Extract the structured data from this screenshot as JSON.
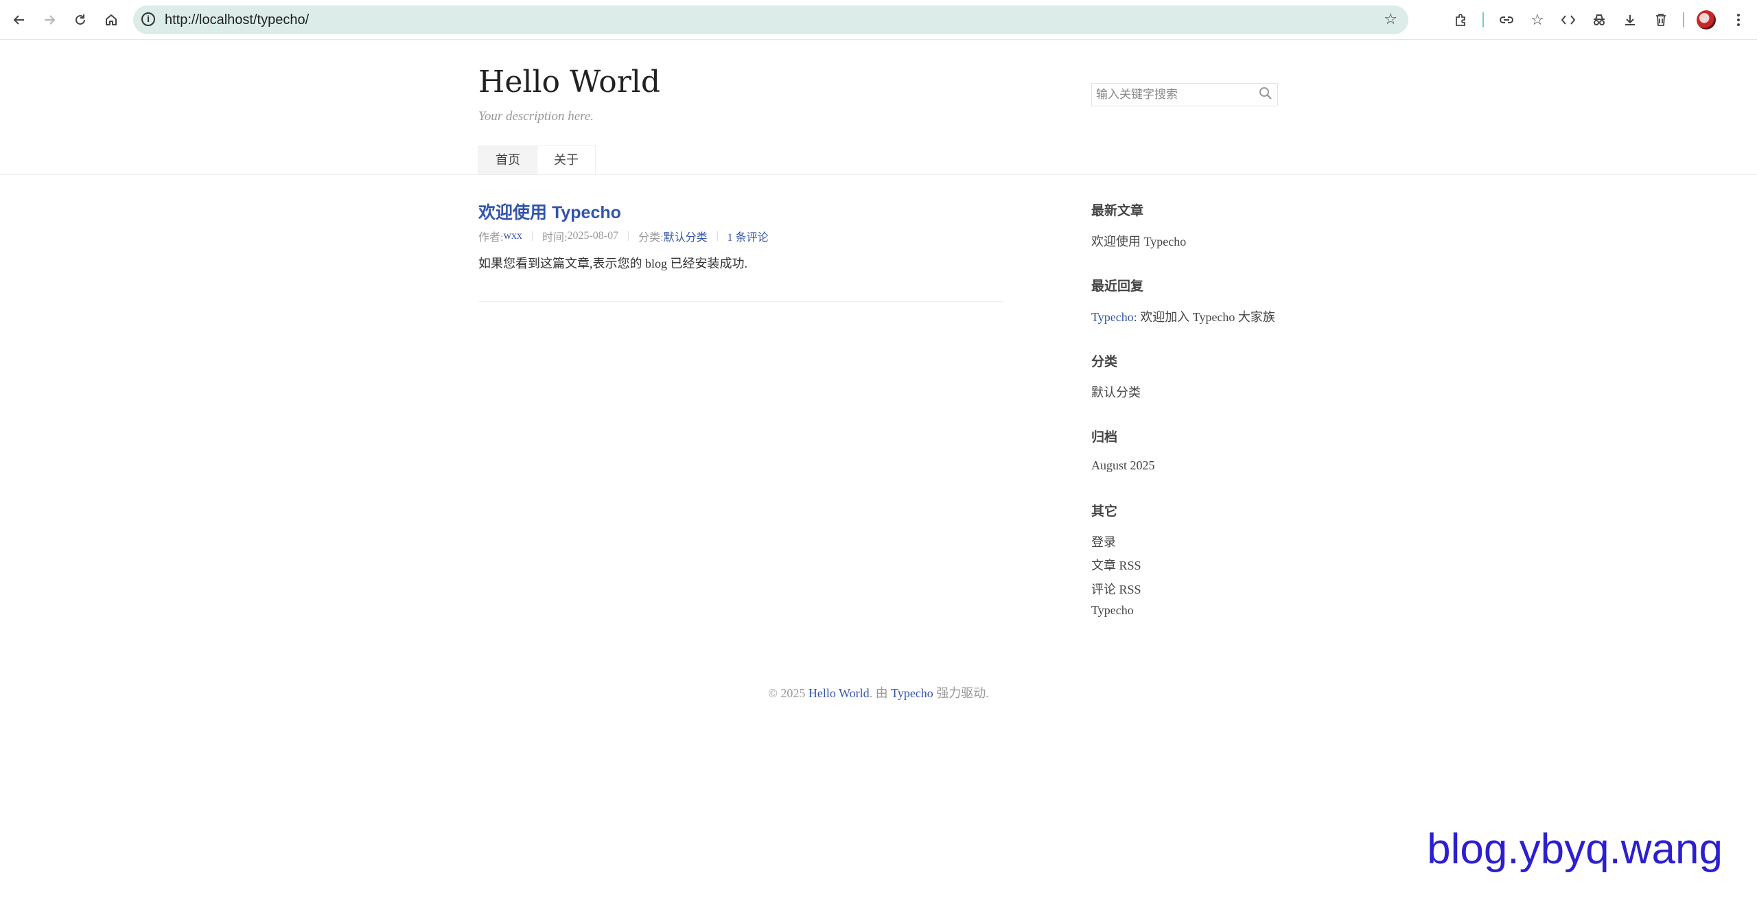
{
  "browser": {
    "url": "http://localhost/typecho/",
    "nav_icons": [
      "back-arrow-icon",
      "forward-arrow-icon",
      "reload-icon",
      "home-icon"
    ],
    "toolbar_icons": [
      "extensions-icon",
      "link-icon",
      "bookmark-star-icon",
      "code-icon",
      "incognito-icon",
      "download-icon",
      "trash-icon",
      "profile-avatar",
      "more-vert-icon"
    ],
    "omnibox_color": "#dcece8"
  },
  "site": {
    "title": "Hello World",
    "description": "Your description here.",
    "search": {
      "placeholder": "输入关键字搜索",
      "value": ""
    },
    "nav": [
      {
        "label": "首页",
        "active": true
      },
      {
        "label": "关于",
        "active": false
      }
    ]
  },
  "post": {
    "title": "欢迎使用 Typecho",
    "meta": {
      "author_label": "作者: ",
      "author": "wxx",
      "time_label": "时间: ",
      "time": "2025-08-07",
      "category_label": "分类: ",
      "category": "默认分类",
      "comments": "1 条评论"
    },
    "content": "如果您看到这篇文章,表示您的 blog 已经安装成功."
  },
  "sidebar": {
    "recent_posts": {
      "title": "最新文章",
      "items": [
        "欢迎使用 Typecho"
      ]
    },
    "recent_comments": {
      "title": "最近回复",
      "author": "Typecho",
      "text": ": 欢迎加入 Typecho 大家族"
    },
    "categories": {
      "title": "分类",
      "items": [
        "默认分类"
      ]
    },
    "archives": {
      "title": "归档",
      "items": [
        "August 2025"
      ]
    },
    "other": {
      "title": "其它",
      "items": [
        "登录",
        "文章 RSS",
        "评论 RSS",
        "Typecho"
      ]
    }
  },
  "footer": {
    "prefix": "© 2025 ",
    "site_link": "Hello World",
    "middle": ". 由 ",
    "powered_link": "Typecho",
    "suffix": " 强力驱动."
  },
  "watermark": "blog.ybyq.wang",
  "colors": {
    "link": "#3354aa",
    "watermark": "#2b1fd0"
  }
}
